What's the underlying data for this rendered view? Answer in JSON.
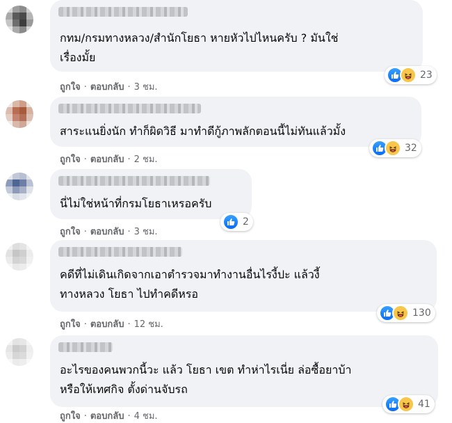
{
  "actions": {
    "like_label": "ถูกใจ",
    "reply_label": "ตอบกลับ",
    "separator": "·"
  },
  "colors": {
    "bubble": "#f0f2f5",
    "like_blue": "#1877f2",
    "haha_yellow": "#f7c64a",
    "meta_grey": "#65676b"
  },
  "comments": [
    {
      "text_lines": [
        "กทม/กรมทางหลวง/สำนักโยธา หายหัวไปไหนครับ ? มันใช่",
        "เรื่องมั้ย"
      ],
      "reactions": [
        "like-icon",
        "haha-icon"
      ],
      "reaction_count": "23",
      "time": "3 ชม."
    },
    {
      "text_lines": [
        "สาระแนยิ่งนัก ทำก็ผิดวิธี มาทำดีกู้ภาพลักตอนนี้ไม่ทันแล้วมั้ง"
      ],
      "reactions": [
        "like-icon",
        "haha-icon"
      ],
      "reaction_count": "32",
      "time": "2 ชม."
    },
    {
      "text_lines": [
        "นี่ไม่ใช่หน้าที่กรมโยธาเหรอครับ"
      ],
      "reactions": [
        "like-icon"
      ],
      "reaction_count": "2",
      "time": "3 ชม."
    },
    {
      "text_lines": [
        "คดีที่ไม่เดินเกิดจากเอาตำรวจมาทำงานอื่นไรงี้ปะ แล้วงี้",
        "ทางหลวง โยธา ไปทำคดีหรอ"
      ],
      "reactions": [
        "like-icon",
        "haha-icon"
      ],
      "reaction_count": "130",
      "time": "12 ชม."
    },
    {
      "text_lines": [
        "อะไรของคนพวกนี้วะ แล้ว โยธา เขต ทำห่าไรเนี่ย ล่อซื้อยาบ้า",
        "หรือให้เทศกิจ ตั้งด่านจับรถ"
      ],
      "reactions": [
        "like-icon",
        "haha-icon"
      ],
      "reaction_count": "41",
      "time": "4 ชม."
    }
  ]
}
